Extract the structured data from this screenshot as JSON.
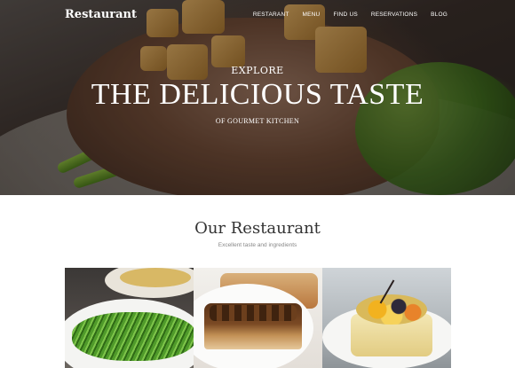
{
  "header": {
    "brand": "Restaurant",
    "menu": [
      "RESTARANT",
      "MENU",
      "FIND US",
      "RESERVATIONS",
      "BLOG"
    ]
  },
  "hero": {
    "kicker": "EXPLORE",
    "headline": "THE DELICIOUS TASTE",
    "sub": "OF GOURMET KITCHEN"
  },
  "section": {
    "title": "Our Restaurant",
    "subtitle": "Excellent taste and ingredients"
  },
  "gallery": [
    {
      "name": "green-onion-dish-image"
    },
    {
      "name": "pecan-pie-image"
    },
    {
      "name": "fruit-cake-image"
    }
  ]
}
